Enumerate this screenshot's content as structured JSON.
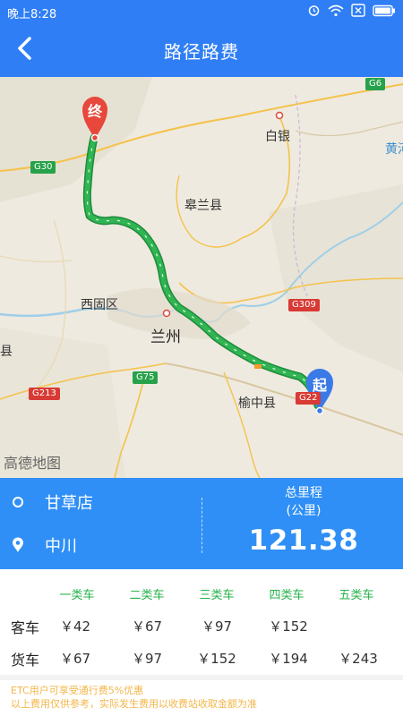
{
  "status_bar": {
    "time": "晚上8:28",
    "icons": [
      "alarm-icon",
      "wifi-icon",
      "sim-off-icon",
      "battery-icon"
    ]
  },
  "header": {
    "title": "路径路费",
    "back_icon": "chevron-left-icon"
  },
  "map": {
    "labels": {
      "baiyin": "白银",
      "huang": "黄河",
      "gaolan": "皋兰县",
      "xigu": "西固区",
      "lanzhou": "兰州",
      "yuzhong": "榆中县",
      "xian": "县"
    },
    "roads": {
      "g6": "G6",
      "g30": "G30",
      "g309": "G309",
      "g75": "G75",
      "g213": "G213",
      "g22": "G22"
    },
    "markers": {
      "end": "终",
      "start": "起"
    },
    "logo": "高德地图",
    "colors": {
      "route": "#1fa64a",
      "marker": "#e8473b",
      "start_marker": "#3a7ae8"
    }
  },
  "summary": {
    "origin": "甘草店",
    "destination": "中川",
    "distance_label_line1": "总里程",
    "distance_label_line2": "(公里)",
    "distance_value": "121.38"
  },
  "fees": {
    "columns": [
      "一类车",
      "二类车",
      "三类车",
      "四类车",
      "五类车"
    ],
    "rows": [
      {
        "label": "客车",
        "values": [
          "￥42",
          "￥67",
          "￥97",
          "￥152",
          ""
        ]
      },
      {
        "label": "货车",
        "values": [
          "￥67",
          "￥97",
          "￥152",
          "￥194",
          "￥243"
        ]
      }
    ]
  },
  "notes": {
    "line1": "ETC用户可享受通行费5%优惠",
    "line2": "以上费用仅供参考，实际发生费用以收费站收取金额为准"
  }
}
